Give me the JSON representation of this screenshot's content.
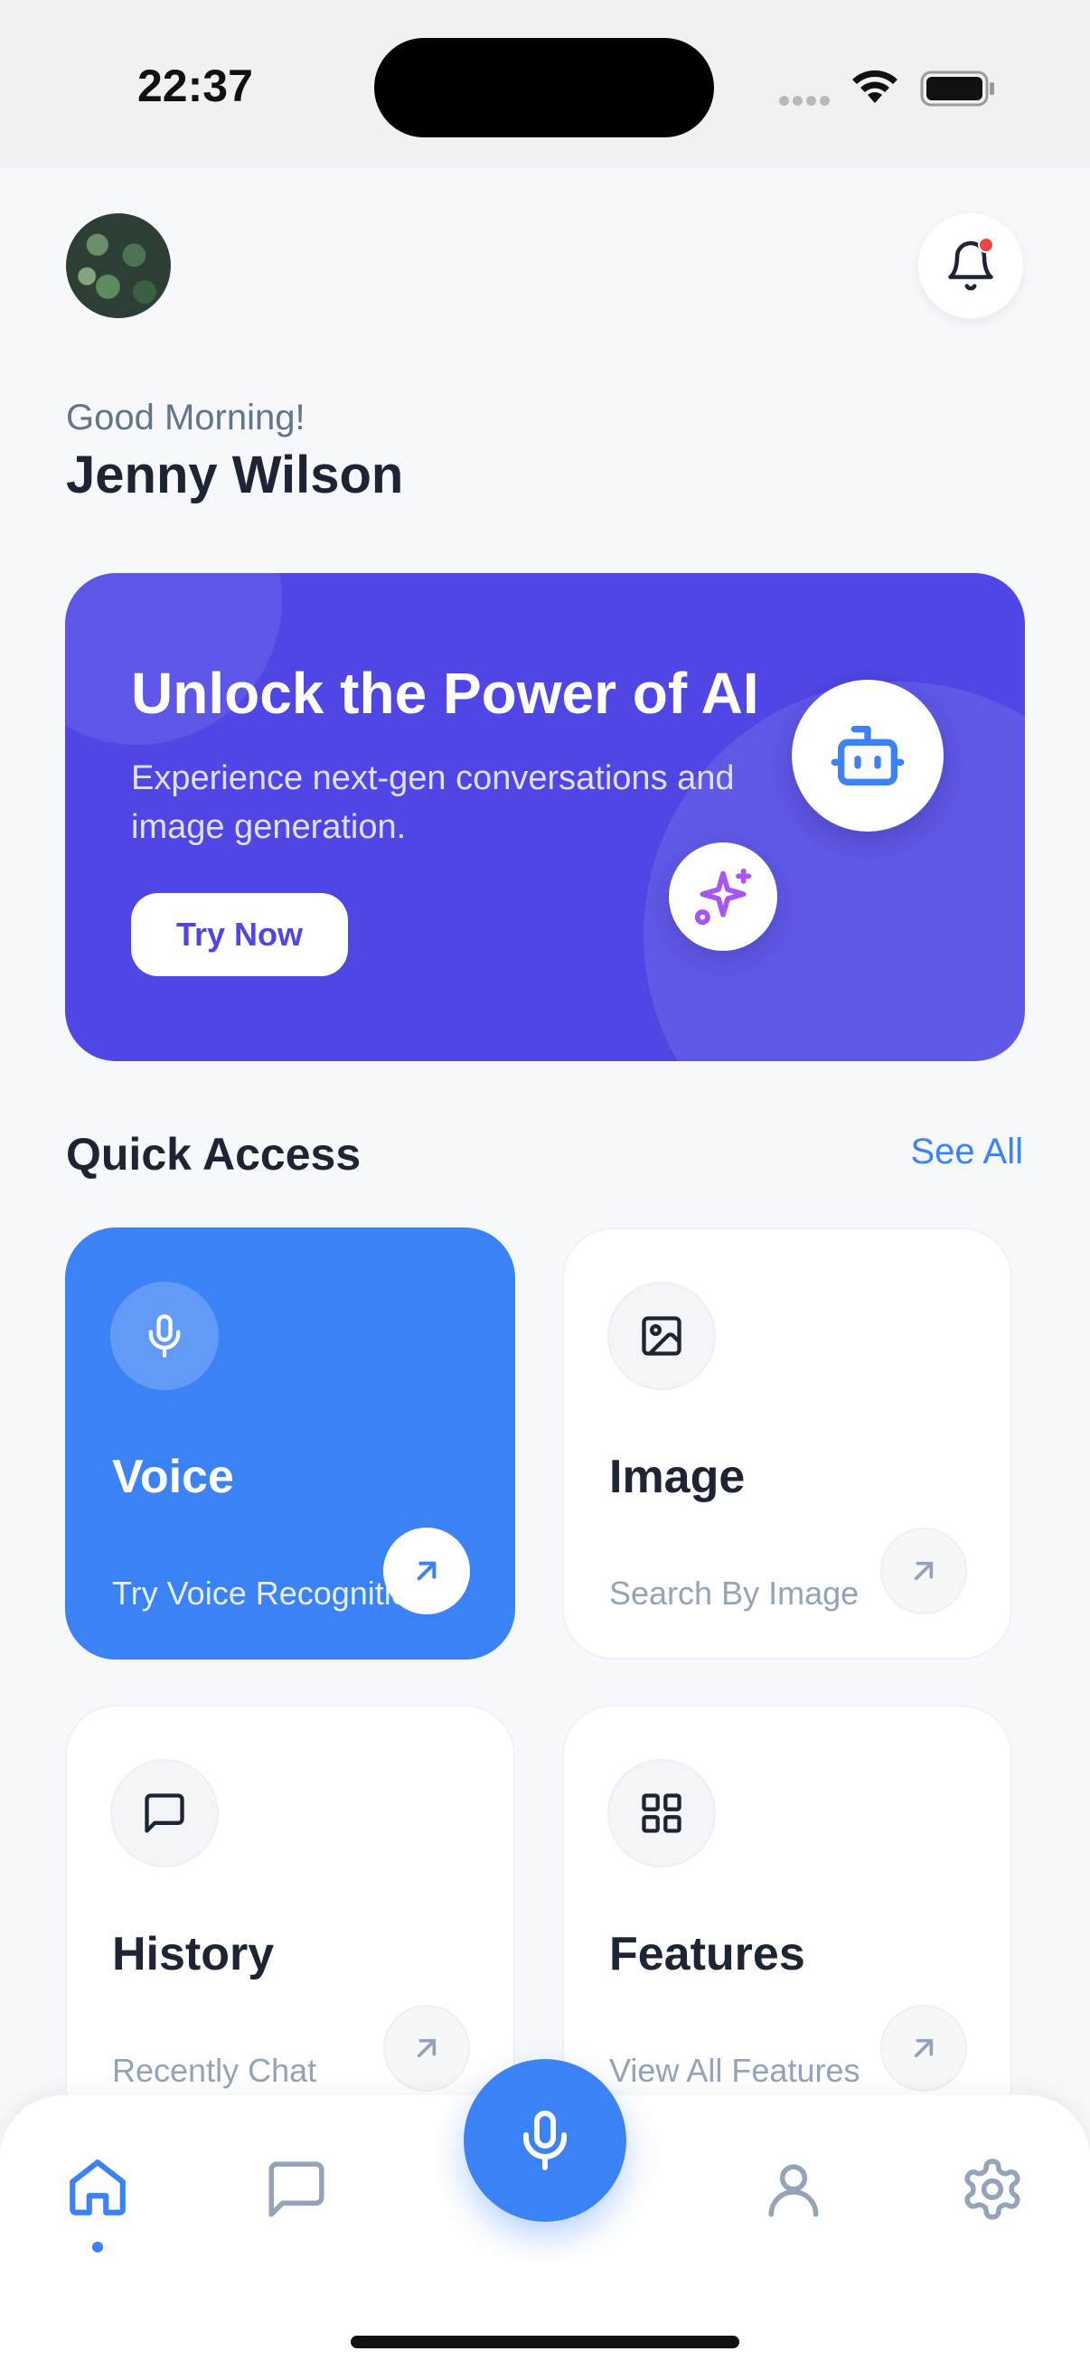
{
  "status_bar": {
    "time": "22:37"
  },
  "header": {
    "avatar": "avatar",
    "notification_icon": "bell-icon",
    "has_notification": true,
    "greeting": "Good Morning!",
    "user_name": "Jenny Wilson"
  },
  "promo": {
    "title": "Unlock the Power of AI",
    "subtitle": "Experience next-gen conversations and image generation.",
    "button_label": "Try Now",
    "icons": [
      "robot-icon",
      "sparkle-icon"
    ],
    "background_color": "#4f46e5"
  },
  "quick_access": {
    "title": "Quick Access",
    "see_all_label": "See All",
    "tiles": [
      {
        "title": "Voice",
        "subtitle": "Try Voice Recognition",
        "icon": "microphone-icon",
        "highlighted": true
      },
      {
        "title": "Image",
        "subtitle": "Search By Image",
        "icon": "image-icon",
        "highlighted": false
      },
      {
        "title": "History",
        "subtitle": "Recently Chat",
        "icon": "chat-bubble-icon",
        "highlighted": false
      },
      {
        "title": "Features",
        "subtitle": "View All Features",
        "icon": "grid-icon",
        "highlighted": false
      }
    ]
  },
  "bottom_nav": {
    "items": [
      {
        "name": "home",
        "icon": "home-icon",
        "active": true
      },
      {
        "name": "chat",
        "icon": "chat-bubble-icon",
        "active": false
      },
      {
        "name": "voice",
        "icon": "microphone-icon",
        "active": false
      },
      {
        "name": "profile",
        "icon": "user-icon",
        "active": false
      },
      {
        "name": "settings",
        "icon": "gear-icon",
        "active": false
      }
    ]
  },
  "colors": {
    "accent": "#3b82f6",
    "promo": "#4f46e5",
    "notification_dot": "#ef4444",
    "sparkle": "#a855f7"
  }
}
